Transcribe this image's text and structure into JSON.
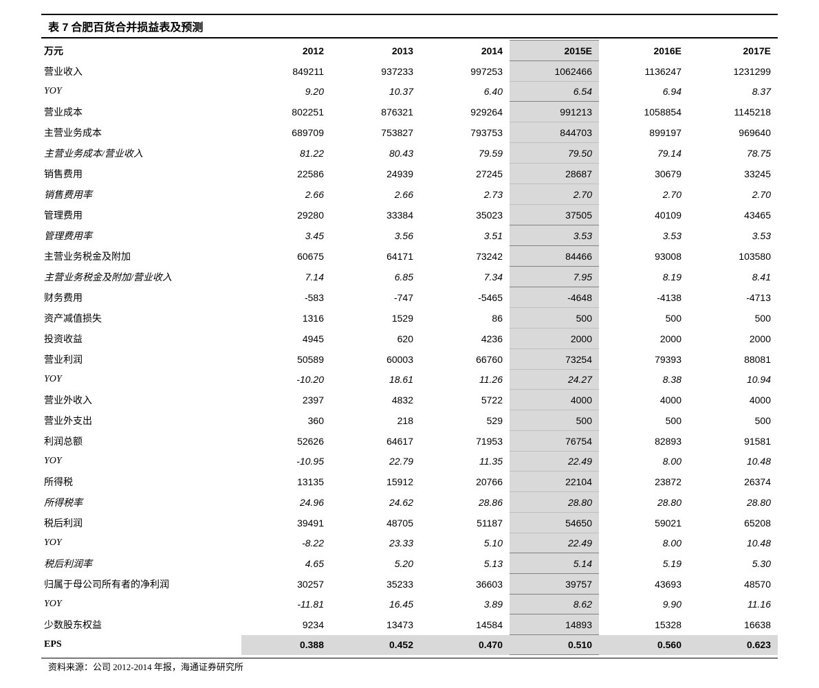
{
  "title_prefix": "表 7",
  "title_text": "合肥百货合并损益表及预测",
  "source": "资料来源：公司 2012-2014 年报，海通证券研究所",
  "header": {
    "label": "万元",
    "y2012": "2012",
    "y2013": "2013",
    "y2014": "2014",
    "y2015": "2015E",
    "y2016": "2016E",
    "y2017": "2017E"
  },
  "rows": [
    {
      "label": "营业收入",
      "y2012": "849211",
      "y2013": "937233",
      "y2014": "997253",
      "y2015": "1062466",
      "y2016": "1136247",
      "y2017": "1231299",
      "italic": false,
      "sec": "start"
    },
    {
      "label": "YOY",
      "y2012": "9.20",
      "y2013": "10.37",
      "y2014": "6.40",
      "y2015": "6.54",
      "y2016": "6.94",
      "y2017": "8.37",
      "italic": true,
      "sec": "end"
    },
    {
      "label": "营业成本",
      "y2012": "802251",
      "y2013": "876321",
      "y2014": "929264",
      "y2015": "991213",
      "y2016": "1058854",
      "y2017": "1145218",
      "italic": false,
      "sec": "start"
    },
    {
      "label": "主营业务成本",
      "y2012": "689709",
      "y2013": "753827",
      "y2014": "793753",
      "y2015": "844703",
      "y2016": "899197",
      "y2017": "969640",
      "italic": false,
      "sec": ""
    },
    {
      "label": "主营业务成本/营业收入",
      "y2012": "81.22",
      "y2013": "80.43",
      "y2014": "79.59",
      "y2015": "79.50",
      "y2016": "79.14",
      "y2017": "78.75",
      "italic": true,
      "sec": ""
    },
    {
      "label": "销售费用",
      "y2012": "22586",
      "y2013": "24939",
      "y2014": "27245",
      "y2015": "28687",
      "y2016": "30679",
      "y2017": "33245",
      "italic": false,
      "sec": ""
    },
    {
      "label": "销售费用率",
      "y2012": "2.66",
      "y2013": "2.66",
      "y2014": "2.73",
      "y2015": "2.70",
      "y2016": "2.70",
      "y2017": "2.70",
      "italic": true,
      "sec": ""
    },
    {
      "label": "管理费用",
      "y2012": "29280",
      "y2013": "33384",
      "y2014": "35023",
      "y2015": "37505",
      "y2016": "40109",
      "y2017": "43465",
      "italic": false,
      "sec": "end"
    },
    {
      "label": "管理费用率",
      "y2012": "3.45",
      "y2013": "3.56",
      "y2014": "3.51",
      "y2015": "3.53",
      "y2016": "3.53",
      "y2017": "3.53",
      "italic": true,
      "sec": "single"
    },
    {
      "label": "主营业务税金及附加",
      "y2012": "60675",
      "y2013": "64171",
      "y2014": "73242",
      "y2015": "84466",
      "y2016": "93008",
      "y2017": "103580",
      "italic": false,
      "sec": "single"
    },
    {
      "label": "主营业务税金及附加/营业收入",
      "y2012": "7.14",
      "y2013": "6.85",
      "y2014": "7.34",
      "y2015": "7.95",
      "y2016": "8.19",
      "y2017": "8.41",
      "italic": true,
      "sec": "single"
    },
    {
      "label": "财务费用",
      "y2012": "-583",
      "y2013": "-747",
      "y2014": "-5465",
      "y2015": "-4648",
      "y2016": "-4138",
      "y2017": "-4713",
      "italic": false,
      "sec": "start"
    },
    {
      "label": "资产减值损失",
      "y2012": "1316",
      "y2013": "1529",
      "y2014": "86",
      "y2015": "500",
      "y2016": "500",
      "y2017": "500",
      "italic": false,
      "sec": ""
    },
    {
      "label": "投资收益",
      "y2012": "4945",
      "y2013": "620",
      "y2014": "4236",
      "y2015": "2000",
      "y2016": "2000",
      "y2017": "2000",
      "italic": false,
      "sec": ""
    },
    {
      "label": "营业利润",
      "y2012": "50589",
      "y2013": "60003",
      "y2014": "66760",
      "y2015": "73254",
      "y2016": "79393",
      "y2017": "88081",
      "italic": false,
      "sec": ""
    },
    {
      "label": "YOY",
      "y2012": "-10.20",
      "y2013": "18.61",
      "y2014": "11.26",
      "y2015": "24.27",
      "y2016": "8.38",
      "y2017": "10.94",
      "italic": true,
      "sec": ""
    },
    {
      "label": "营业外收入",
      "y2012": "2397",
      "y2013": "4832",
      "y2014": "5722",
      "y2015": "4000",
      "y2016": "4000",
      "y2017": "4000",
      "italic": false,
      "sec": ""
    },
    {
      "label": "营业外支出",
      "y2012": "360",
      "y2013": "218",
      "y2014": "529",
      "y2015": "500",
      "y2016": "500",
      "y2017": "500",
      "italic": false,
      "sec": ""
    },
    {
      "label": "利润总额",
      "y2012": "52626",
      "y2013": "64617",
      "y2014": "71953",
      "y2015": "76754",
      "y2016": "82893",
      "y2017": "91581",
      "italic": false,
      "sec": ""
    },
    {
      "label": "YOY",
      "y2012": "-10.95",
      "y2013": "22.79",
      "y2014": "11.35",
      "y2015": "22.49",
      "y2016": "8.00",
      "y2017": "10.48",
      "italic": true,
      "sec": ""
    },
    {
      "label": "所得税",
      "y2012": "13135",
      "y2013": "15912",
      "y2014": "20766",
      "y2015": "22104",
      "y2016": "23872",
      "y2017": "26374",
      "italic": false,
      "sec": ""
    },
    {
      "label": "所得税率",
      "y2012": "24.96",
      "y2013": "24.62",
      "y2014": "28.86",
      "y2015": "28.80",
      "y2016": "28.80",
      "y2017": "28.80",
      "italic": true,
      "sec": ""
    },
    {
      "label": "税后利润",
      "y2012": "39491",
      "y2013": "48705",
      "y2014": "51187",
      "y2015": "54650",
      "y2016": "59021",
      "y2017": "65208",
      "italic": false,
      "sec": ""
    },
    {
      "label": "YOY",
      "y2012": "-8.22",
      "y2013": "23.33",
      "y2014": "5.10",
      "y2015": "22.49",
      "y2016": "8.00",
      "y2017": "10.48",
      "italic": true,
      "sec": "end"
    },
    {
      "label": "税后利润率",
      "y2012": "4.65",
      "y2013": "5.20",
      "y2014": "5.13",
      "y2015": "5.14",
      "y2016": "5.19",
      "y2017": "5.30",
      "italic": true,
      "sec": "single"
    },
    {
      "label": "归属于母公司所有者的净利润",
      "y2012": "30257",
      "y2013": "35233",
      "y2014": "36603",
      "y2015": "39757",
      "y2016": "43693",
      "y2017": "48570",
      "italic": false,
      "sec": "single"
    },
    {
      "label": "YOY",
      "y2012": "-11.81",
      "y2013": "16.45",
      "y2014": "3.89",
      "y2015": "8.62",
      "y2016": "9.90",
      "y2017": "11.16",
      "italic": true,
      "sec": "single"
    },
    {
      "label": "少数股东权益",
      "y2012": "9234",
      "y2013": "13473",
      "y2014": "14584",
      "y2015": "14893",
      "y2016": "15328",
      "y2017": "16638",
      "italic": false,
      "sec": "single"
    }
  ],
  "eps_row": {
    "label": "EPS",
    "y2012": "0.388",
    "y2013": "0.452",
    "y2014": "0.470",
    "y2015": "0.510",
    "y2016": "0.560",
    "y2017": "0.623"
  }
}
